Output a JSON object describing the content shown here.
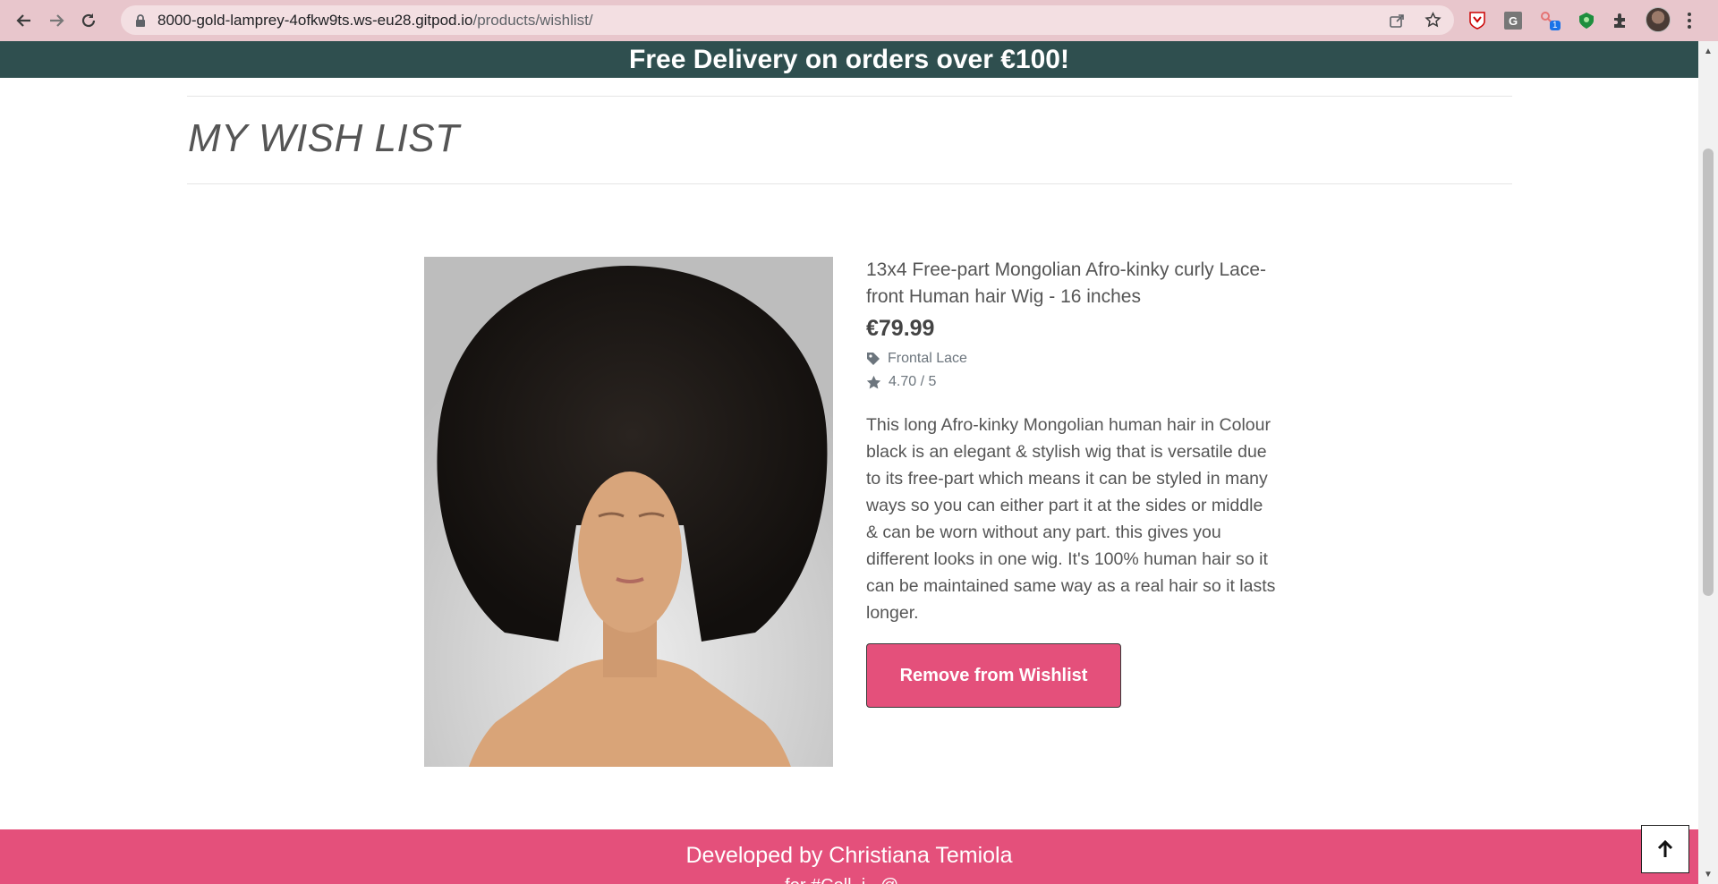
{
  "browser": {
    "url_host": "8000-gold-lamprey-4ofkw9ts.ws-eu28.gitpod.io",
    "url_path": "/products/wishlist/",
    "ext_badge": "1"
  },
  "colors": {
    "banner_bg": "#2f4f4f",
    "accent_pink": "#e4507b",
    "chrome_pink": "#e8c6cc"
  },
  "banner": {
    "text": "Free Delivery on orders over €100!"
  },
  "page": {
    "title": "MY WISH LIST"
  },
  "product": {
    "name": "13x4 Free-part Mongolian Afro-kinky curly Lace-front Human hair Wig - 16 inches",
    "price": "€79.99",
    "category": "Frontal Lace",
    "rating": "4.70 / 5",
    "description": "This long Afro-kinky Mongolian human hair in Colour black is an elegant & stylish wig that is versatile due to its free-part which means it can be styled in many ways so you can either part it at the sides or middle & can be worn without any part. this gives you different looks in one wig. It's 100% human hair so it can be maintained same way as a real hair so it lasts longer.",
    "remove_label": "Remove from Wishlist"
  },
  "footer": {
    "credit": "Developed by Christiana Temiola",
    "credit_line2": "for #Coll..i.. @..."
  },
  "icons": [
    "back-icon",
    "forward-icon",
    "reload-icon",
    "lock-icon",
    "share-icon",
    "star-icon",
    "puzzle-icon",
    "tag-icon",
    "rating-star-icon",
    "arrow-up-icon"
  ]
}
